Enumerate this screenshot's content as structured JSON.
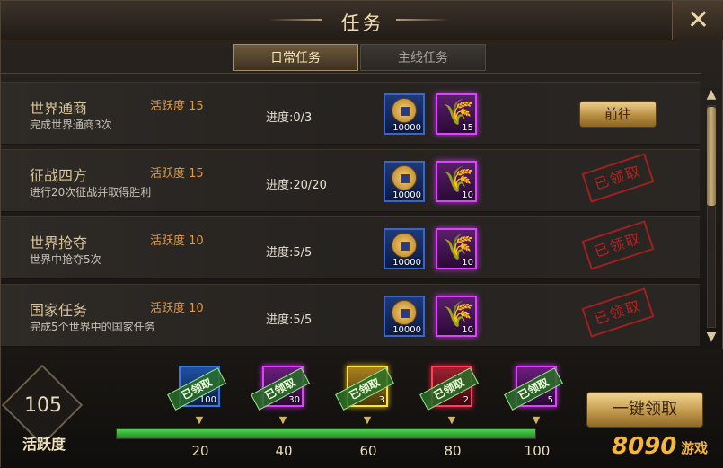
{
  "window": {
    "title": "任务",
    "close_glyph": "✕"
  },
  "tabs": [
    {
      "label": "日常任务",
      "active": true
    },
    {
      "label": "主线任务",
      "active": false
    }
  ],
  "tasks": [
    {
      "name": "世界通商",
      "desc": "完成世界通商3次",
      "activity": "活跃度 15",
      "progress": "进度:0/3",
      "coin_count": "10000",
      "wheat_count": "15",
      "action": "前往"
    },
    {
      "name": "征战四方",
      "desc": "进行20次征战并取得胜利",
      "activity": "活跃度 15",
      "progress": "进度:20/20",
      "coin_count": "10000",
      "wheat_count": "10",
      "stamp": "已领取"
    },
    {
      "name": "世界抢夺",
      "desc": "世界中抢夺5次",
      "activity": "活跃度 10",
      "progress": "进度:5/5",
      "coin_count": "10000",
      "wheat_count": "10",
      "stamp": "已领取"
    },
    {
      "name": "国家任务",
      "desc": "完成5个世界中的国家任务",
      "activity": "活跃度 10",
      "progress": "进度:5/5",
      "coin_count": "10000",
      "wheat_count": "10",
      "stamp": "已领取"
    }
  ],
  "activity": {
    "value": "105",
    "label": "活跃度",
    "progress_fraction": 1.0
  },
  "milestones": [
    {
      "threshold": "20",
      "count": "100",
      "tag": "已领取",
      "color": "blue"
    },
    {
      "threshold": "40",
      "count": "30",
      "tag": "已领取",
      "color": "purple"
    },
    {
      "threshold": "60",
      "count": "3",
      "tag": "已领取",
      "color": "gold"
    },
    {
      "threshold": "80",
      "count": "2",
      "tag": "已领取",
      "color": "red"
    },
    {
      "threshold": "100",
      "count": "5",
      "tag": "已领取",
      "color": "purple"
    }
  ],
  "one_key_button": "一键领取",
  "watermark": {
    "logo": "8090",
    "suffix": "游戏"
  },
  "scroll": {
    "up": "▲",
    "down": "▼"
  },
  "icons": {
    "coin": "copper-coin-icon",
    "wheat": "wheat-icon",
    "chevron": "chevron-down-icon"
  }
}
